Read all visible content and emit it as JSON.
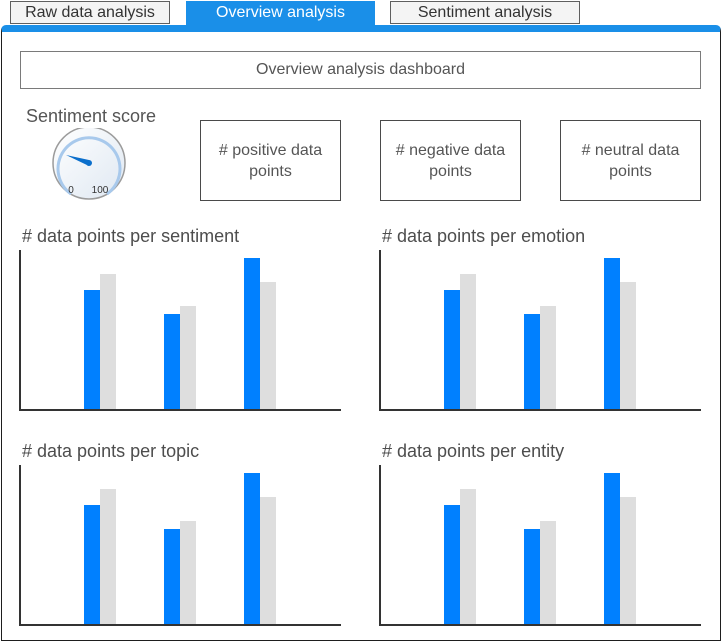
{
  "tabs": [
    {
      "label": "Raw data analysis",
      "active": false
    },
    {
      "label": "Overview analysis",
      "active": true
    },
    {
      "label": "Sentiment analysis",
      "active": false
    }
  ],
  "dashboard": {
    "title": "Overview analysis dashboard",
    "sentiment_gauge": {
      "label": "Sentiment score",
      "min_label": "0",
      "max_label": "100",
      "value": 25
    },
    "stats": [
      {
        "label": "# positive data points"
      },
      {
        "label": "# negative data points"
      },
      {
        "label": "# neutral data points"
      }
    ]
  },
  "colors": {
    "accent": "#1a8fe8",
    "series1": "#0080ff",
    "series2": "#dedede"
  },
  "chart_data": [
    {
      "type": "bar",
      "title": "# data points per sentiment",
      "categories": [
        "",
        "",
        ""
      ],
      "series": [
        {
          "values": [
            75,
            60,
            95
          ]
        },
        {
          "values": [
            85,
            65,
            80
          ]
        }
      ],
      "ylim": [
        0,
        100
      ],
      "grid": false
    },
    {
      "type": "bar",
      "title": "# data points per emotion",
      "categories": [
        "",
        "",
        ""
      ],
      "series": [
        {
          "values": [
            75,
            60,
            95
          ]
        },
        {
          "values": [
            85,
            65,
            80
          ]
        }
      ],
      "ylim": [
        0,
        100
      ],
      "grid": false
    },
    {
      "type": "bar",
      "title": "# data points per topic",
      "categories": [
        "",
        "",
        ""
      ],
      "series": [
        {
          "values": [
            75,
            60,
            95
          ]
        },
        {
          "values": [
            85,
            65,
            80
          ]
        }
      ],
      "ylim": [
        0,
        100
      ],
      "grid": false
    },
    {
      "type": "bar",
      "title": "# data points per entity",
      "categories": [
        "",
        "",
        ""
      ],
      "series": [
        {
          "values": [
            75,
            60,
            95
          ]
        },
        {
          "values": [
            85,
            65,
            80
          ]
        }
      ],
      "ylim": [
        0,
        100
      ],
      "grid": false
    }
  ]
}
